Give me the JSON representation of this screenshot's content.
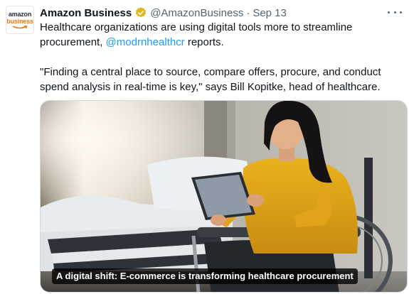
{
  "account": {
    "avatar_line1": "amazon",
    "avatar_line2": "business",
    "name": "Amazon Business",
    "handle": "@AmazonBusiness",
    "separator": "·",
    "date": "Sep 13",
    "verified_icon": "gold-verified-badge-icon"
  },
  "tweet": {
    "line1_text": "Healthcare organizations are using digital tools more to streamline",
    "line2_prefix": "procurement, ",
    "mention": "@modrnhealthcr",
    "line2_suffix": " reports.",
    "quote": "\"Finding a central place to source, compare offers, procure, and conduct spend analysis in real-time is key,\" says Bill Kopitke, head of healthcare."
  },
  "media": {
    "caption": "A digital shift: E-commerce is transforming healthcare procurement"
  },
  "colors": {
    "text": "#0f1419",
    "secondary": "#536471",
    "link": "#1d9bf0",
    "badge": "#e2b719",
    "brand_orange": "#e47911"
  }
}
